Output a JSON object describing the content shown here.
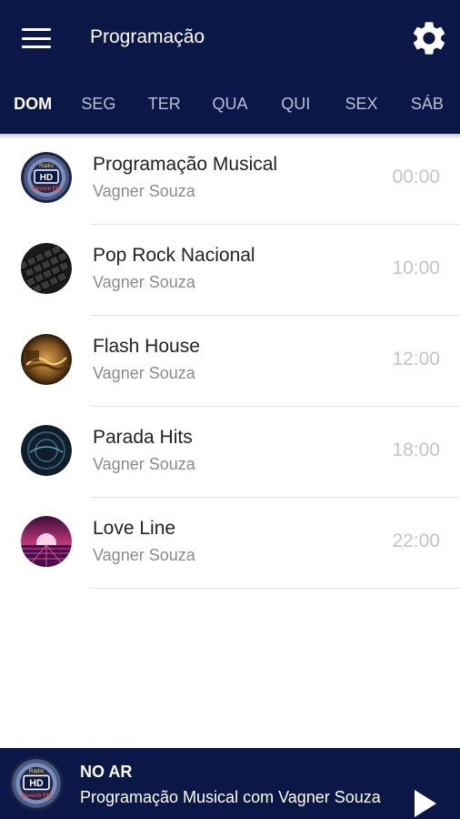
{
  "header": {
    "title": "Programação",
    "menu_icon": "menu-icon",
    "settings_icon": "gear-icon",
    "background_color": "#0b1747"
  },
  "day_tabs": [
    {
      "label": "DOM",
      "active": true
    },
    {
      "label": "SEG",
      "active": false
    },
    {
      "label": "TER",
      "active": false
    },
    {
      "label": "QUA",
      "active": false
    },
    {
      "label": "QUI",
      "active": false
    },
    {
      "label": "SEX",
      "active": false
    },
    {
      "label": "SÁB",
      "active": false
    }
  ],
  "programs": [
    {
      "title": "Programação Musical",
      "host": "Vagner Souza",
      "time": "00:00",
      "thumb": "radio-hd-logo"
    },
    {
      "title": "Pop Rock Nacional",
      "host": "Vagner Souza",
      "time": "10:00",
      "thumb": "keyboard-image"
    },
    {
      "title": "Flash House",
      "host": "Vagner Souza",
      "time": "12:00",
      "thumb": "music-graphic"
    },
    {
      "title": "Parada Hits",
      "host": "Vagner Souza",
      "time": "18:00",
      "thumb": "parada-hits-image"
    },
    {
      "title": "Love Line",
      "host": "Vagner Souza",
      "time": "22:00",
      "thumb": "sunset-grid-image"
    }
  ],
  "player": {
    "status_label": "NO AR",
    "now_playing": "Programação Musical com Vagner Souza",
    "play_icon": "play-icon"
  },
  "logo": {
    "top": "Rádio",
    "middle": "HD",
    "bottom": "Reverb FM"
  }
}
